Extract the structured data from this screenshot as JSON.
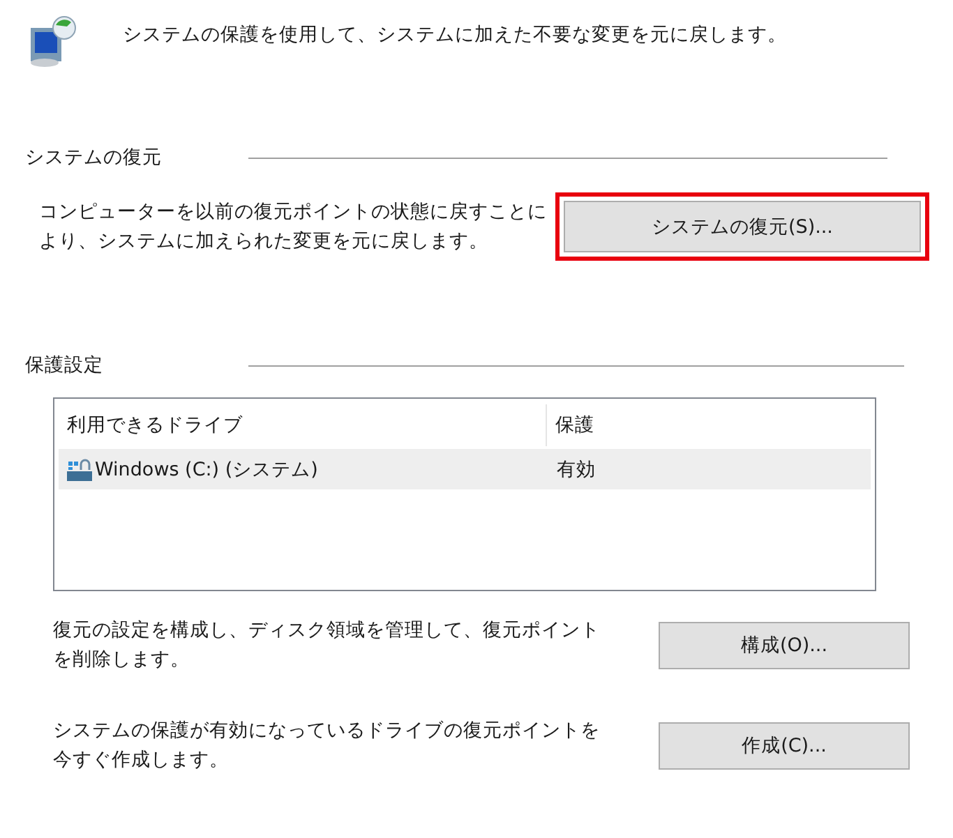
{
  "header": {
    "text": "システムの保護を使用して、システムに加えた不要な変更を元に戻します。"
  },
  "restore": {
    "heading": "システムの復元",
    "description": "コンピューターを以前の復元ポイントの状態に戻すことにより、システムに加えられた変更を元に戻します。",
    "button": "システムの復元(S)...",
    "highlighted": true
  },
  "protection": {
    "heading": "保護設定",
    "table": {
      "columns": [
        "利用できるドライブ",
        "保護"
      ],
      "rows": [
        {
          "drive": "Windows (C:) (システム)",
          "protection": "有効",
          "selected": true
        }
      ]
    },
    "actions": [
      {
        "description": "復元の設定を構成し、ディスク領域を管理して、復元ポイントを削除します。",
        "button": "構成(O)..."
      },
      {
        "description": "システムの保護が有効になっているドライブの復元ポイントを今すぐ作成します。",
        "button": "作成(C)..."
      }
    ]
  }
}
